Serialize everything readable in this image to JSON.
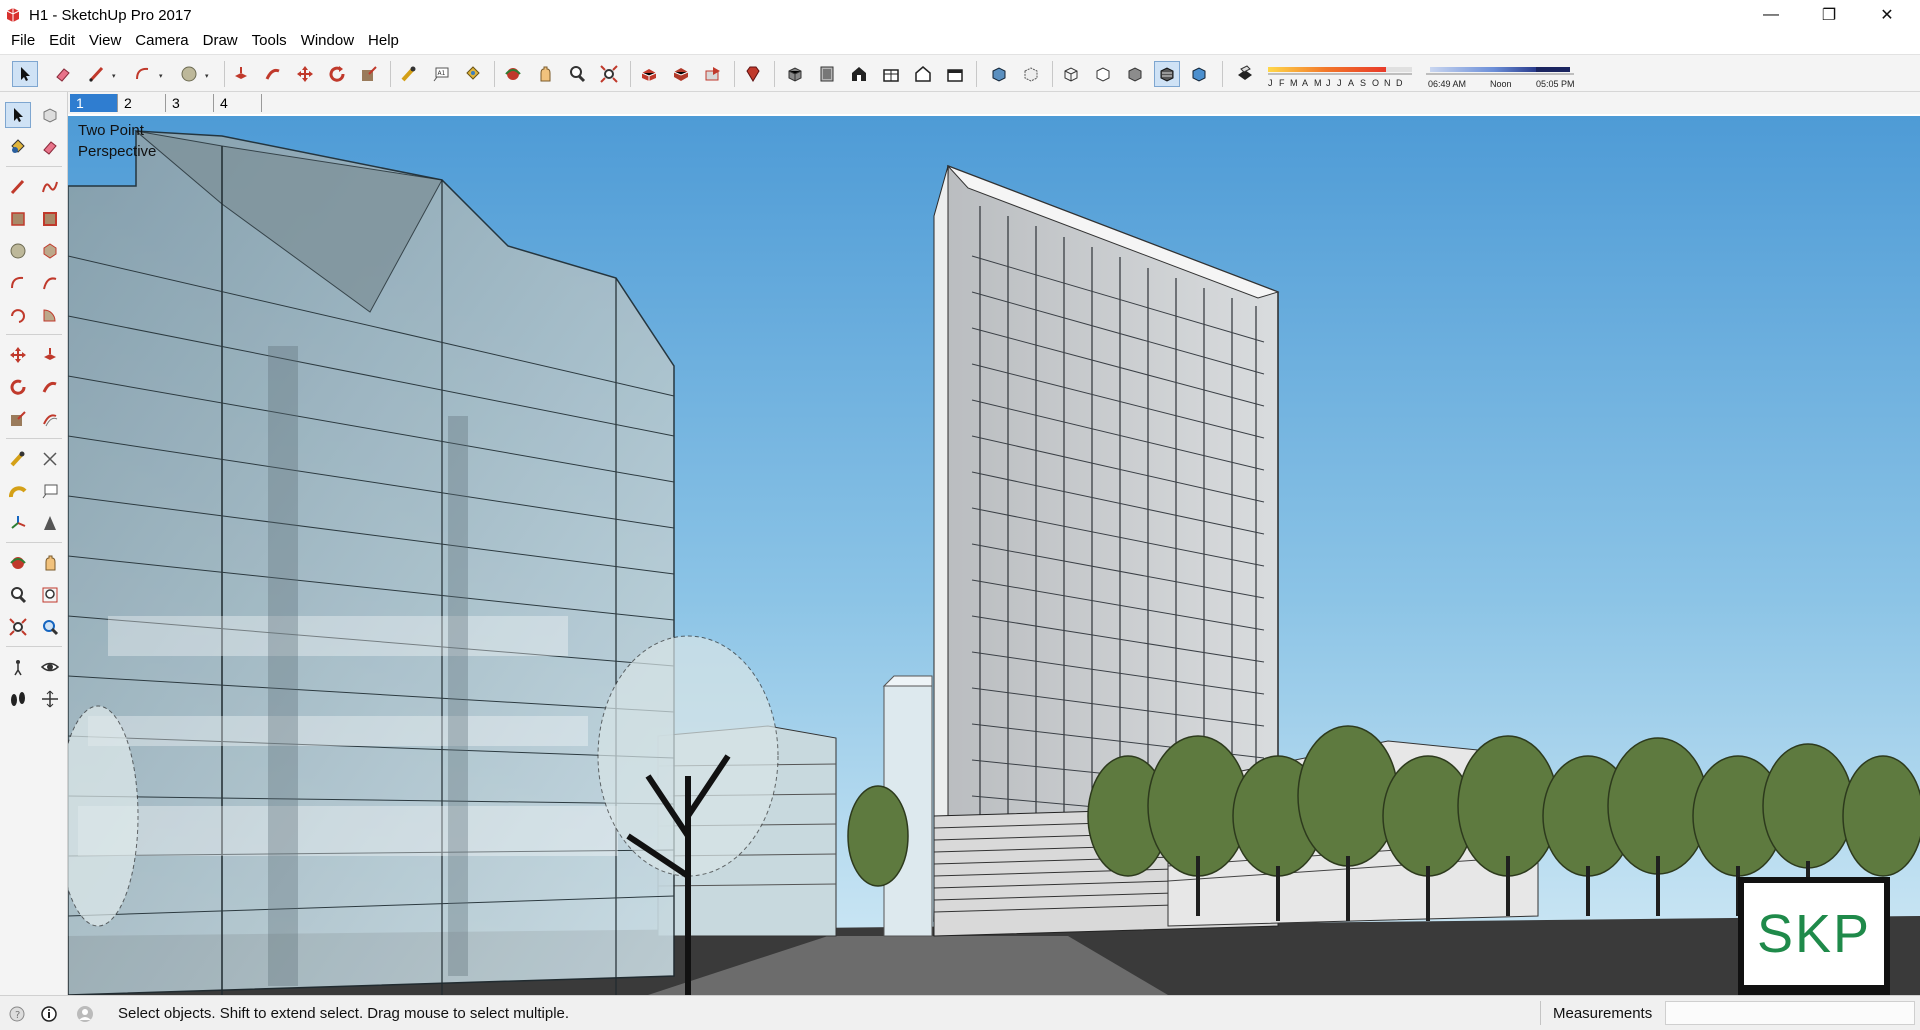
{
  "window": {
    "title": "H1 - SketchUp Pro 2017",
    "minimize_glyph": "—",
    "restore_glyph": "❐",
    "close_glyph": "✕"
  },
  "menu": [
    "File",
    "Edit",
    "View",
    "Camera",
    "Draw",
    "Tools",
    "Window",
    "Help"
  ],
  "shadows": {
    "months": [
      "J",
      "F",
      "M",
      "A",
      "M",
      "J",
      "J",
      "A",
      "S",
      "O",
      "N",
      "D"
    ],
    "time_start": "06:49 AM",
    "time_mid": "Noon",
    "time_end": "05:05 PM"
  },
  "scenes": [
    {
      "label": "1",
      "active": true
    },
    {
      "label": "2",
      "active": false
    },
    {
      "label": "3",
      "active": false
    },
    {
      "label": "4",
      "active": false
    }
  ],
  "viewport": {
    "camera_label": "Two Point Perspective",
    "camera_label_line1": "Two Point",
    "camera_label_line2": "Perspective",
    "watermark": "SKP"
  },
  "status": {
    "hint": "Select objects. Shift to extend select. Drag mouse to select multiple.",
    "measurements_label": "Measurements",
    "measurements_value": ""
  },
  "icons": {
    "top_toolbar": [
      "select-icon",
      "eraser-icon",
      "line-icon",
      "arc-icon",
      "circle-icon",
      "push-pull-icon",
      "follow-me-icon",
      "move-icon",
      "rotate-icon",
      "scale-icon",
      "tape-measure-icon",
      "text-icon",
      "paint-bucket-icon",
      "orbit-icon",
      "pan-icon",
      "zoom-icon",
      "zoom-extents-icon",
      "warehouse-icon",
      "share-model-icon",
      "extension-warehouse-icon",
      "ruby-icon",
      "iso-view-icon",
      "top-view-icon",
      "front-view-icon",
      "right-view-icon",
      "back-view-icon",
      "left-view-icon",
      "xray-icon",
      "back-edges-icon",
      "wireframe-icon",
      "hidden-line-icon",
      "shaded-icon",
      "shaded-textures-icon",
      "monochrome-icon",
      "shadows-toggle-icon"
    ],
    "left_toolbar": [
      "select-icon",
      "make-component-icon",
      "paint-bucket-icon",
      "eraser-icon",
      "line-icon",
      "freehand-icon",
      "rectangle-icon",
      "rotated-rectangle-icon",
      "circle-icon",
      "polygon-icon",
      "arc-icon",
      "two-point-arc-icon",
      "three-point-arc-icon",
      "pie-icon",
      "move-icon",
      "push-pull-icon",
      "rotate-icon",
      "follow-me-icon",
      "scale-icon",
      "offset-icon",
      "tape-measure-icon",
      "dimension-icon",
      "protractor-icon",
      "text-icon",
      "axes-icon",
      "3d-text-icon",
      "orbit-icon",
      "pan-icon",
      "zoom-icon",
      "zoom-window-icon",
      "zoom-extents-icon",
      "previous-view-icon",
      "position-camera-icon",
      "look-around-icon",
      "walk-icon",
      "section-plane-icon"
    ],
    "status": [
      "geo-location-icon",
      "credits-icon",
      "user-account-icon"
    ]
  },
  "colors": {
    "sky_top": "#4e9bd6",
    "sky_bottom": "#d4ebf6",
    "selected_tab": "#2f7dd0",
    "watermark_text": "#1f8a4a"
  }
}
